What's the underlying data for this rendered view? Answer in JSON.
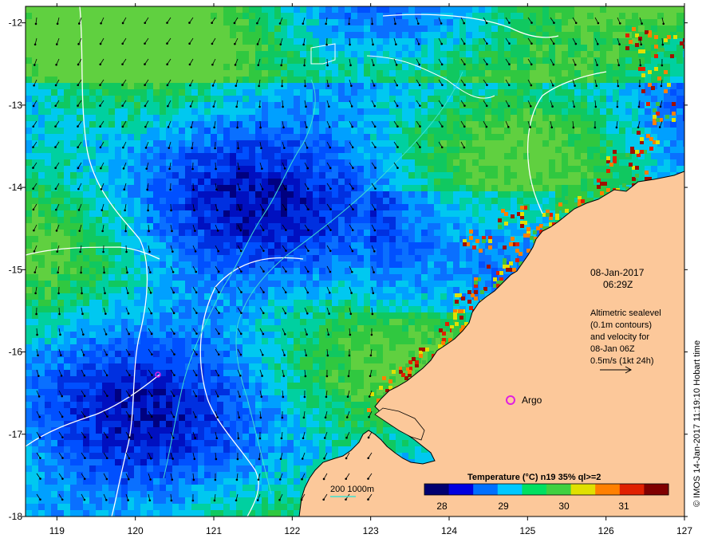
{
  "map": {
    "lon_ticks": [
      "119",
      "120",
      "121",
      "122",
      "123",
      "124",
      "125",
      "126",
      "127"
    ],
    "lat_ticks": [
      "-12",
      "-13",
      "-14",
      "-15",
      "-16",
      "-17",
      "-18"
    ],
    "lon_range": [
      118.6,
      127
    ],
    "lat_range": [
      -11.8,
      -18
    ]
  },
  "info": {
    "date": "08-Jan-2017",
    "time": "06:29Z",
    "alt_line1": "Altimetric sealevel",
    "alt_line2": "(0.1m contours)",
    "alt_line3": "and velocity for",
    "alt_line4": "08-Jan 06Z",
    "alt_line5": "0.5m/s (1kt 24h)"
  },
  "argo": {
    "label": "Argo",
    "marker_color": "#e020e0"
  },
  "bathymetry": {
    "label": "200  1000m"
  },
  "colorbar": {
    "title": "Temperature (°C) n19 35% ql>=2",
    "ticks": [
      "28",
      "29",
      "30",
      "31"
    ],
    "colors": [
      "#000070",
      "#0000e0",
      "#0070ff",
      "#00c8ff",
      "#00e060",
      "#40d040",
      "#e0e000",
      "#ff8000",
      "#e02000",
      "#800000"
    ]
  },
  "credit": "© IMOS 14-Jan-2017 11:19:10 Hobart time",
  "colors": {
    "land": "#fcc89a",
    "coast": "#000000",
    "contour": "#ffffff",
    "bathy": "#40e0d0"
  }
}
